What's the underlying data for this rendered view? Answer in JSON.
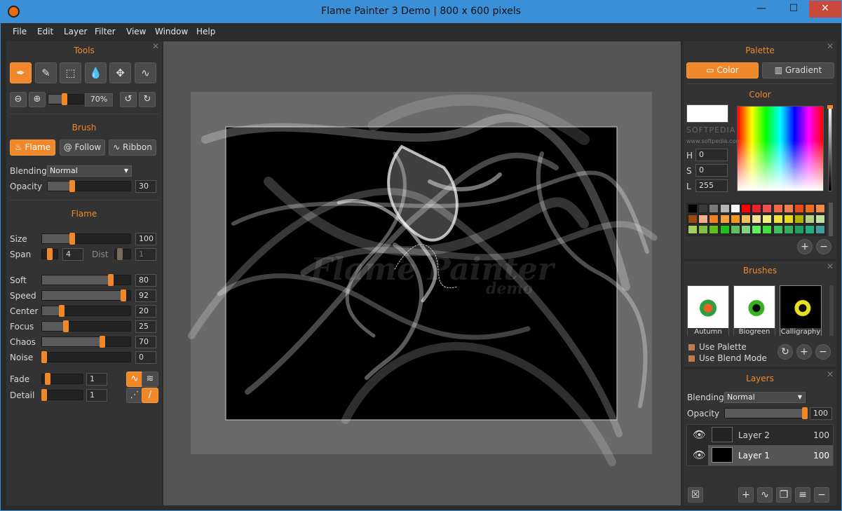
{
  "window": {
    "title": "Flame Painter 3 Demo | 800 x 600 pixels",
    "minimize": "—",
    "maximize": "☐",
    "close": "✕"
  },
  "menu": [
    "File",
    "Edit",
    "Layer",
    "Filter",
    "View",
    "Window",
    "Help"
  ],
  "tools": {
    "title": "Tools",
    "zoom": "70%",
    "zoom_fraction": 0.45
  },
  "brush": {
    "title": "Brush",
    "flame": "Flame",
    "follow": "Follow",
    "ribbon": "Ribbon",
    "blending_label": "Blending",
    "blending_value": "Normal",
    "opacity_label": "Opacity",
    "opacity_value": "30",
    "opacity_fraction": 0.3
  },
  "flame": {
    "title": "Flame",
    "params": [
      {
        "label": "Size",
        "value": "100",
        "fraction": 0.34
      },
      {
        "label": "Soft",
        "value": "80",
        "fraction": 0.78
      },
      {
        "label": "Speed",
        "value": "92",
        "fraction": 0.92
      },
      {
        "label": "Center",
        "value": "20",
        "fraction": 0.22
      },
      {
        "label": "Focus",
        "value": "25",
        "fraction": 0.27
      },
      {
        "label": "Chaos",
        "value": "70",
        "fraction": 0.68
      },
      {
        "label": "Noise",
        "value": "0",
        "fraction": 0.02
      }
    ],
    "span_label": "Span",
    "span_value": "4",
    "dist_label": "Dist",
    "dist_value": "1",
    "fade_label": "Fade",
    "fade_value": "1",
    "detail_label": "Detail",
    "detail_value": "1"
  },
  "palette": {
    "title": "Palette",
    "color_tab": "Color",
    "gradient_tab": "Gradient",
    "color_title": "Color",
    "h_label": "H",
    "h_value": "0",
    "s_label": "S",
    "s_value": "0",
    "l_label": "L",
    "l_value": "255",
    "swatches": [
      "#000000",
      "#3a3a3a",
      "#7a7a7a",
      "#b4b4b4",
      "#ffffff",
      "#ff0000",
      "#e8242e",
      "#f05050",
      "#f06a4a",
      "#f08050",
      "#e84a1a",
      "#f06a20",
      "#f08a4a",
      "#9a4a10",
      "#f0b090",
      "#f08020",
      "#f0a040",
      "#f09820",
      "#f0c060",
      "#f0e0a0",
      "#f0f080",
      "#f0e040",
      "#e8d820",
      "#b4b400",
      "#b4d080",
      "#c0e0a0",
      "#a0d060",
      "#80c040",
      "#60c020",
      "#20c020",
      "#60c060",
      "#80d080",
      "#60f060",
      "#40e040",
      "#40c060",
      "#30b060",
      "#20a060",
      "#20b080",
      "#40a0a0"
    ]
  },
  "brushes": {
    "title": "Brushes",
    "items": [
      "Autumn",
      "Biogreen",
      "Calligraphy"
    ],
    "use_palette": "Use Palette",
    "use_blend": "Use Blend Mode"
  },
  "layers": {
    "title": "Layers",
    "blending_label": "Blending",
    "blending_value": "Normal",
    "opacity_label": "Opacity",
    "opacity_value": "100",
    "opacity_fraction": 1.0,
    "list": [
      {
        "name": "Layer 2",
        "value": "100"
      },
      {
        "name": "Layer 1",
        "value": "100"
      }
    ]
  },
  "watermark": {
    "softpedia": "SOFTPEDIA",
    "softpedia_url": "www.softpedia.com",
    "demo": "Flame Painter",
    "demo_sub": "demo"
  }
}
